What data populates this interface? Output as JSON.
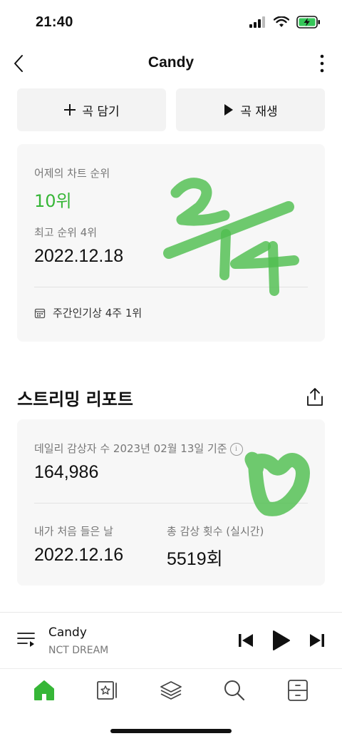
{
  "status_bar": {
    "time": "21:40"
  },
  "header": {
    "title": "Candy"
  },
  "actions": {
    "add_label": "곡 담기",
    "play_label": "곡 재생"
  },
  "chart_card": {
    "yesterday_label": "어제의 차트 순위",
    "yesterday_rank": "10위",
    "best_label": "최고 순위 4위",
    "best_date": "2022.12.18",
    "weekly": "주간인기상 4주 1위"
  },
  "report": {
    "title": "스트리밍 리포트",
    "daily_label": "데일리 감상자 수 2023년 02월 13일 기준",
    "daily_value": "164,986",
    "first_listen_label": "내가 처음 들은 날",
    "first_listen_value": "2022.12.16",
    "total_label": "총 감상 횟수 (실시간)",
    "total_value": "5519회"
  },
  "mini_player": {
    "title": "Candy",
    "artist": "NCT DREAM"
  },
  "colors": {
    "accent_green": "#36b637",
    "doodle_green": "#4fbe4f"
  }
}
